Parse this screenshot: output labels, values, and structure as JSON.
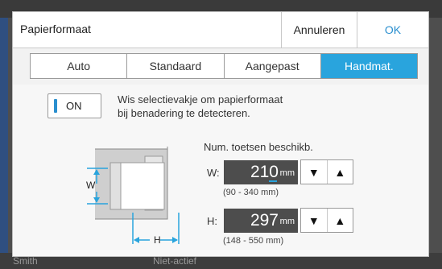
{
  "dialog": {
    "title": "Papierformaat",
    "cancel_label": "Annuleren",
    "ok_label": "OK"
  },
  "tabs": [
    {
      "label": "Auto",
      "active": false
    },
    {
      "label": "Standaard",
      "active": false
    },
    {
      "label": "Aangepast",
      "active": false
    },
    {
      "label": "Handmat.",
      "active": true
    }
  ],
  "auto_detect": {
    "toggle_label": "ON",
    "description_line1": "Wis selectievakje om papierformaat",
    "description_line2": "bij benadering te detecteren."
  },
  "illustration": {
    "w_label": "W",
    "h_label": "H"
  },
  "numeric_hint": "Num. toetsen beschikb.",
  "width_field": {
    "label": "W:",
    "value": "210",
    "unit": "mm",
    "range": "(90 - 340 mm)"
  },
  "height_field": {
    "label": "H:",
    "value": "297",
    "unit": "mm",
    "range": "(148 - 550 mm)"
  },
  "background": {
    "footer_user": "Smith",
    "footer_status": "Niet-actief"
  },
  "colors": {
    "accent": "#29a4dd",
    "ok_text": "#2a8fcf",
    "value_box": "#4d4d4d"
  }
}
